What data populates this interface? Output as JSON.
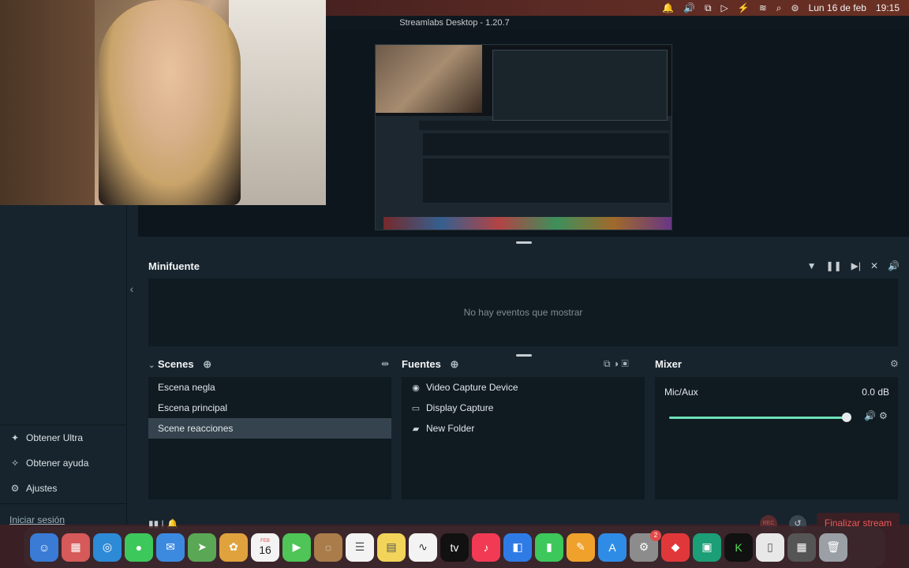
{
  "menubar": {
    "items": [
      "🔔",
      "🔊",
      "⧉",
      "▷",
      "⚡"
    ],
    "wifi": "≋",
    "search": "⌕",
    "control": "⊜",
    "date": "Lun 16 de feb",
    "time": "19:15"
  },
  "window": {
    "title": "Streamlabs Desktop - 1.20.7"
  },
  "sidebar": {
    "items": [
      {
        "label": "Obtener Ultra",
        "icon": "ultra-icon"
      },
      {
        "label": "Obtener ayuda",
        "icon": "help-icon"
      },
      {
        "label": "Ajustes",
        "icon": "gear-icon"
      }
    ],
    "login": "Iniciar sesión"
  },
  "minifeed": {
    "title": "Minifuente",
    "empty": "No hay eventos que mostrar"
  },
  "scenes": {
    "title": "Scenes",
    "items": [
      "Escena negla",
      "Escena principal",
      "Scene reacciones"
    ],
    "selected": 2
  },
  "sources": {
    "title": "Fuentes",
    "items": [
      {
        "label": "Video Capture Device",
        "icon": "camera-icon"
      },
      {
        "label": "Display Capture",
        "icon": "monitor-icon"
      },
      {
        "label": "New Folder",
        "icon": "folder-icon"
      }
    ]
  },
  "mixer": {
    "title": "Mixer",
    "channel": "Mic/Aux",
    "level": "0.0 dB"
  },
  "footer": {
    "rec": "REC",
    "end_stream": "Finalizar stream"
  },
  "dock": {
    "calendar_month": "FEB",
    "calendar_day": "16",
    "appletv": "tv",
    "badge": "2"
  },
  "colors": {
    "accent": "#6de0b8",
    "danger": "#ea5b5b"
  }
}
